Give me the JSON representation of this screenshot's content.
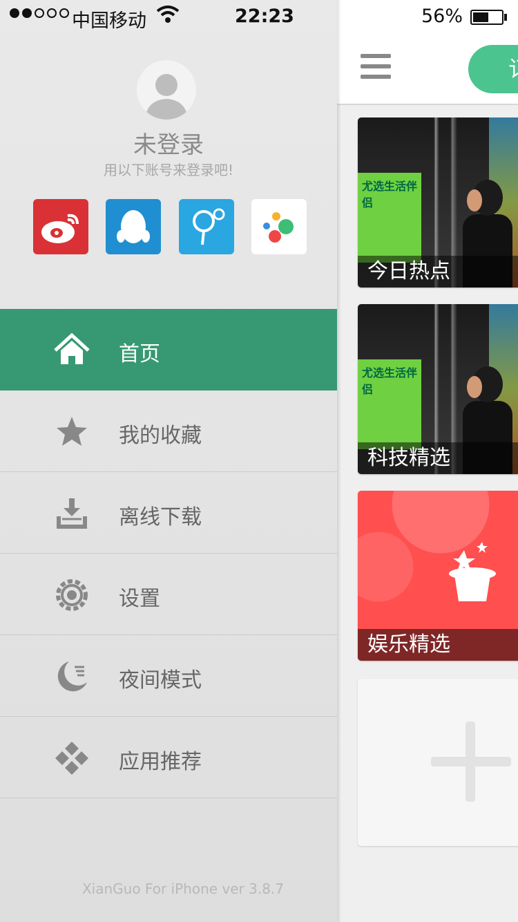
{
  "status_bar": {
    "carrier": "中国移动",
    "time": "22:23",
    "battery": "56%",
    "signal_bars": [
      1,
      1,
      0,
      0,
      0
    ]
  },
  "profile": {
    "title": "未登录",
    "subtitle": "用以下账号来登录吧!"
  },
  "social_logins": [
    {
      "name": "weibo",
      "icon": "weibo-icon",
      "color": "#d93135"
    },
    {
      "name": "qq",
      "icon": "qq-penguin-icon",
      "color": "#1f8fd1"
    },
    {
      "name": "music",
      "icon": "earphone-icon",
      "color": "#2aa6e0"
    },
    {
      "name": "other",
      "icon": "colored-dots-icon",
      "color": "#ffffff"
    }
  ],
  "menu": [
    {
      "label": "首页",
      "icon": "home-icon",
      "active": true
    },
    {
      "label": "我的收藏",
      "icon": "star-icon"
    },
    {
      "label": "离线下载",
      "icon": "download-tray-icon"
    },
    {
      "label": "设置",
      "icon": "gear-icon"
    },
    {
      "label": "夜间模式",
      "icon": "moon-icon"
    },
    {
      "label": "应用推荐",
      "icon": "diamond-grid-icon"
    }
  ],
  "version": "XianGuo For iPhone ver 3.8.7",
  "main": {
    "nav_button_text": "订",
    "cards": [
      {
        "caption": "今日热点"
      },
      {
        "caption": "科技精选"
      },
      {
        "caption": "娱乐精选"
      }
    ]
  },
  "colors": {
    "accent_green": "#379874",
    "pill_green": "#4cc48f",
    "red_card": "#ff4f4f"
  }
}
